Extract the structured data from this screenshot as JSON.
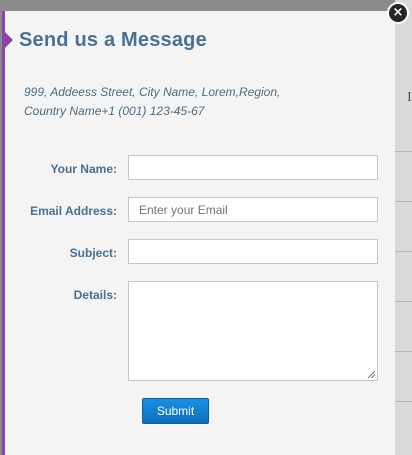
{
  "modal": {
    "title": "Send us a Message",
    "address_line1": "999, Addeess Street, City Name, Lorem,Region,",
    "address_line2": "Country Name+1 (001) 123-45-67"
  },
  "form": {
    "name_label": "Your Name:",
    "name_value": "",
    "email_label": "Email Address:",
    "email_placeholder": "Enter your Email",
    "subject_label": "Subject:",
    "subject_value": "",
    "details_label": "Details:",
    "details_value": "",
    "submit_label": "Submit"
  },
  "close": {
    "glyph": "×"
  },
  "background": {
    "visible_letter": "I"
  },
  "colors": {
    "accent": "#8e44ad",
    "title": "#4a7193",
    "button": "#1a8fe0"
  }
}
